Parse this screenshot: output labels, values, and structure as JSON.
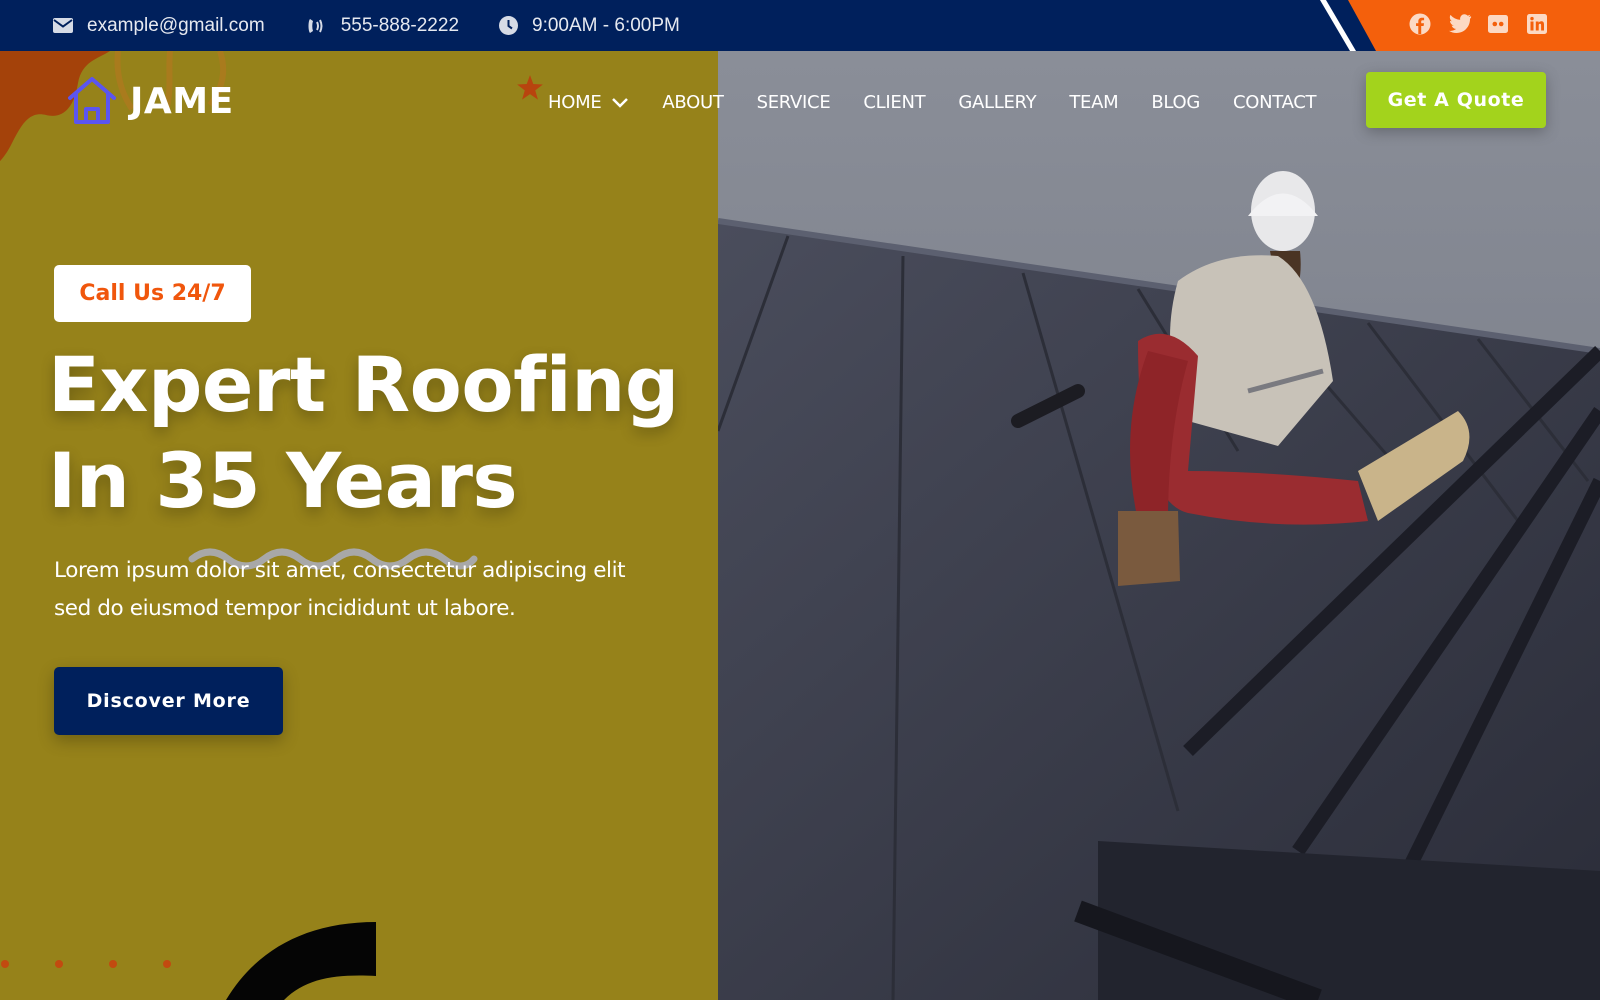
{
  "topbar": {
    "email": "example@gmail.com",
    "phone": "555-888-2222",
    "hours": "9:00AM - 6:00PM",
    "email_icon": "envelope-icon",
    "phone_icon": "phone-ringing-icon",
    "hours_icon": "clock-icon",
    "social": [
      {
        "name": "facebook",
        "icon": "facebook-icon"
      },
      {
        "name": "twitter",
        "icon": "twitter-icon"
      },
      {
        "name": "flickr",
        "icon": "flickr-icon"
      },
      {
        "name": "linkedin",
        "icon": "linkedin-icon"
      }
    ]
  },
  "brand": {
    "name": "JAME",
    "logo_icon": "house-icon"
  },
  "nav": {
    "items": [
      {
        "label": "HOME",
        "has_dropdown": true
      },
      {
        "label": "ABOUT"
      },
      {
        "label": "SERVICE"
      },
      {
        "label": "CLIENT"
      },
      {
        "label": "GALLERY"
      },
      {
        "label": "TEAM"
      },
      {
        "label": "BLOG"
      },
      {
        "label": "CONTACT"
      }
    ],
    "cta_label": "Get A Quote"
  },
  "hero": {
    "badge": "Call Us 24/7",
    "headline_line1": "Expert Roofing",
    "headline_line2": "In 35 Years",
    "description_line1": "Lorem ipsum dolor sit amet, consectetur adipiscing elit",
    "description_line2": "sed do eiusmod tempor incididunt ut labore.",
    "button_label": "Discover More",
    "image_alt": "Roofer in hard hat sitting on metal roof cutting with snips"
  },
  "colors": {
    "navy": "#00205c",
    "orange": "#f4600c",
    "olive": "#96821a",
    "lime": "#a3d31c",
    "logo_purple": "#5b55f0"
  }
}
